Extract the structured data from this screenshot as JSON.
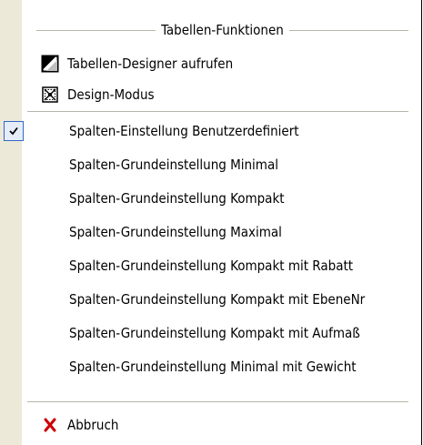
{
  "menu": {
    "header_title": "Tabellen-Funktionen",
    "designer_label": "Tabellen-Designer aufrufen",
    "design_mode_label": "Design-Modus",
    "column_items": [
      {
        "label": "Spalten-Einstellung Benutzerdefiniert",
        "checked": true
      },
      {
        "label": "Spalten-Grundeinstellung Minimal",
        "checked": false
      },
      {
        "label": "Spalten-Grundeinstellung Kompakt",
        "checked": false
      },
      {
        "label": "Spalten-Grundeinstellung Maximal",
        "checked": false
      },
      {
        "label": "Spalten-Grundeinstellung Kompakt mit Rabatt",
        "checked": false
      },
      {
        "label": "Spalten-Grundeinstellung Kompakt mit EbeneNr",
        "checked": false
      },
      {
        "label": "Spalten-Grundeinstellung Kompakt mit Aufmaß",
        "checked": false
      },
      {
        "label": "Spalten-Grundeinstellung Minimal mit Gewicht",
        "checked": false
      }
    ],
    "cancel_label": "Abbruch",
    "icons": {
      "designer": "table-designer-icon",
      "design_mode": "design-mode-icon",
      "check": "checkmark-icon",
      "cancel": "red-x-icon"
    },
    "colors": {
      "gutter": "#ece9d8",
      "check_highlight": "#e6edf9",
      "check_border": "#316ac5",
      "cancel_icon": "#cc0000",
      "separator": "#b7b6a8"
    }
  }
}
